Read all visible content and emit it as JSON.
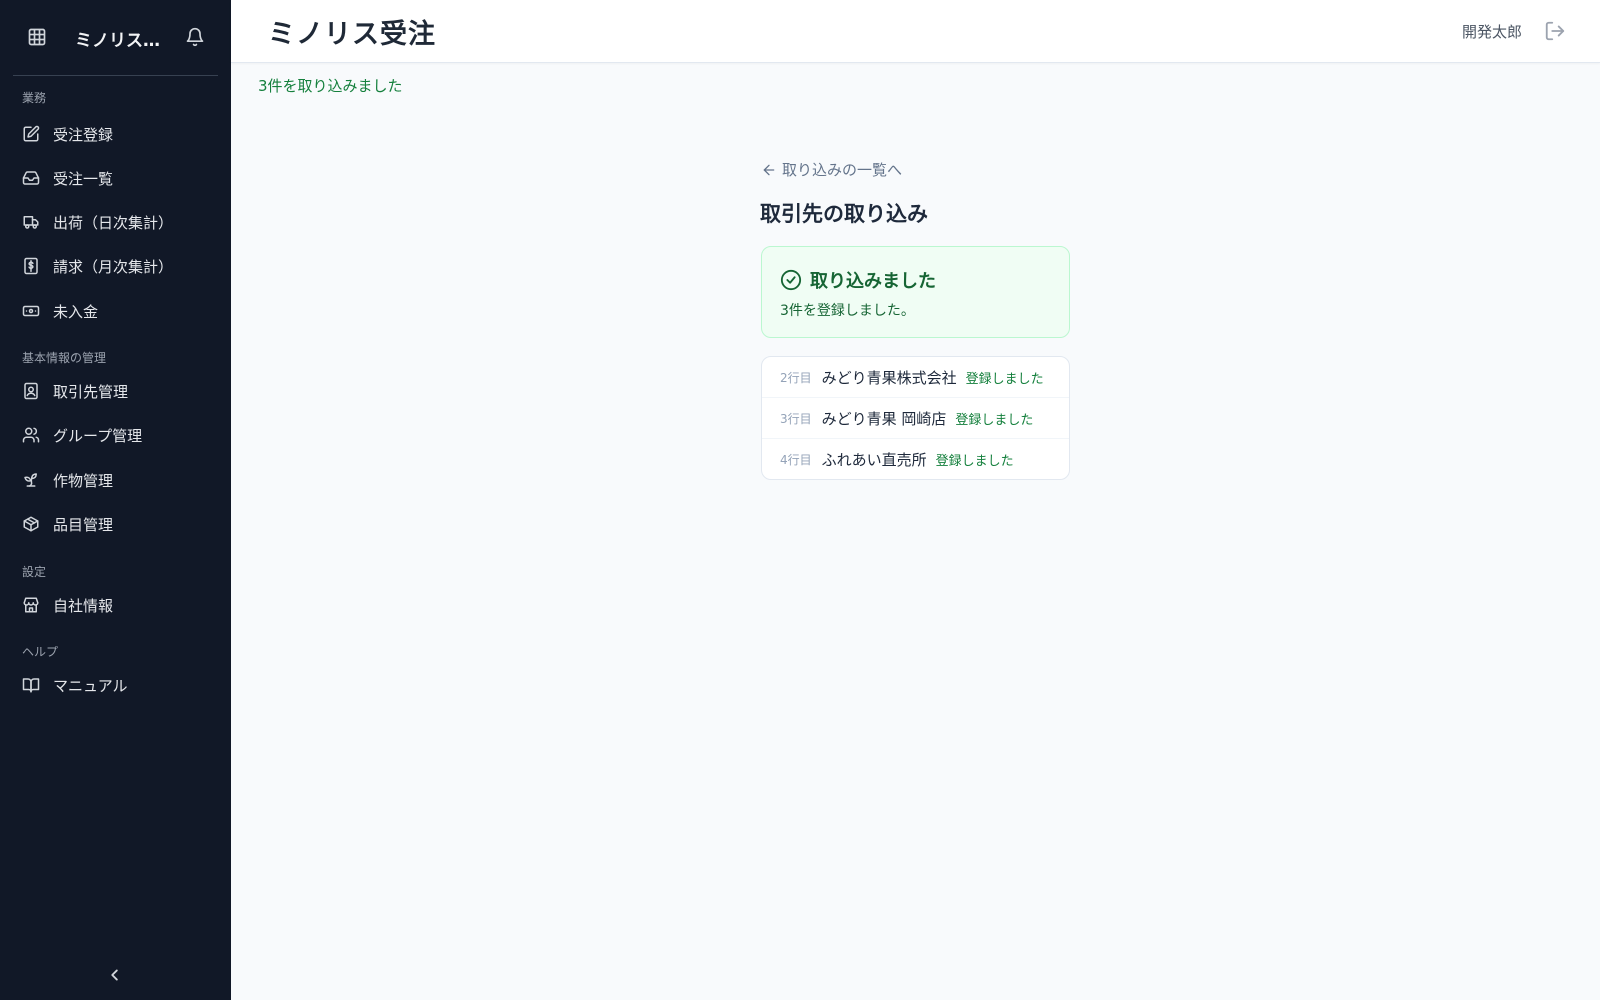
{
  "sidebar": {
    "title": "ミノリス…",
    "sections": [
      "業務",
      "基本情報の管理",
      "設定",
      "ヘルプ"
    ],
    "items": [
      {
        "label": "受注登録",
        "icon": "edit-icon"
      },
      {
        "label": "受注一覧",
        "icon": "inbox-icon"
      },
      {
        "label": "出荷（日次集計）",
        "icon": "truck-icon"
      },
      {
        "label": "請求（月次集計）",
        "icon": "invoice-icon"
      },
      {
        "label": "未入金",
        "icon": "banknote-icon"
      },
      {
        "label": "取引先管理",
        "icon": "contact-icon"
      },
      {
        "label": "グループ管理",
        "icon": "users-icon"
      },
      {
        "label": "作物管理",
        "icon": "sprout-icon"
      },
      {
        "label": "品目管理",
        "icon": "package-icon"
      },
      {
        "label": "自社情報",
        "icon": "store-icon"
      },
      {
        "label": "マニュアル",
        "icon": "book-icon"
      }
    ]
  },
  "header": {
    "title": "ミノリス受注",
    "user": "開発太郎"
  },
  "flash": "3件を取り込みました",
  "main": {
    "back_label": "取り込みの一覧へ",
    "page_title": "取引先の取り込み",
    "success": {
      "title": "取り込みました",
      "message": "3件を登録しました。"
    },
    "results": [
      {
        "row": "2行目",
        "name": "みどり青果株式会社",
        "status": "登録しました"
      },
      {
        "row": "3行目",
        "name": "みどり青果 岡崎店",
        "status": "登録しました"
      },
      {
        "row": "4行目",
        "name": "ふれあい直売所",
        "status": "登録しました"
      }
    ]
  },
  "colors": {
    "sidebar_bg": "#111827",
    "success_green": "#15803d",
    "success_bg": "#f0fdf4"
  }
}
